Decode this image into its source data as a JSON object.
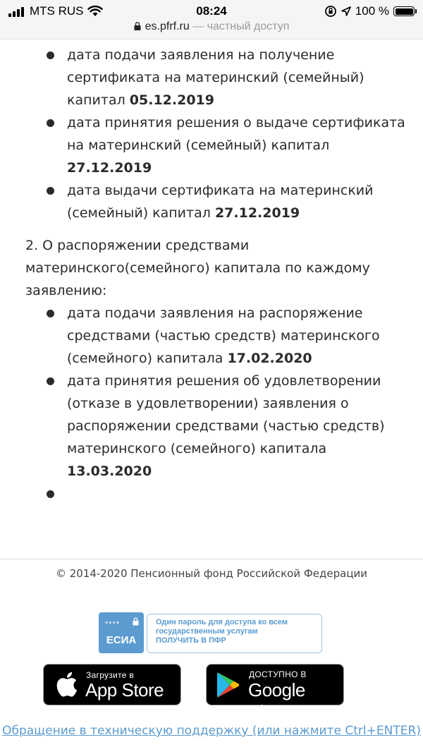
{
  "status_bar": {
    "carrier": "MTS RUS",
    "time": "08:24",
    "battery": "100 %"
  },
  "url_bar": {
    "domain": "es.pfrf.ru",
    "subtitle": "— частный доступ"
  },
  "content": {
    "list1": [
      {
        "text": "дата подачи заявления на получение сертификата на материнский (семейный) капитал ",
        "date": "05.12.2019"
      },
      {
        "text": "дата принятия решения о выдаче сертификата на материнский (семейный) капитал ",
        "date": "27.12.2019"
      },
      {
        "text": "дата выдачи сертификата на материнский (семейный) капитал ",
        "date": "27.12.2019"
      }
    ],
    "section2_heading": "2. О распоряжении средствами материнского(семейного) капитала по каждому заявлению:",
    "list2": [
      {
        "text": "дата подачи заявления на распоряжение средствами (частью средств) материнского (семейного) капитала ",
        "date": "17.02.2020"
      },
      {
        "text": "дата принятия решения об удовлетворении (отказе в удовлетворении) заявления о распоряжении средствами (частью средств) материнского (семейного) капитала ",
        "date": "13.03.2020"
      },
      {
        "text": "",
        "date": ""
      }
    ]
  },
  "footer": {
    "copyright": "© 2014-2020 Пенсионный фонд Российской Федерации",
    "esia": {
      "stars": "****",
      "name": "ЕСИА",
      "line1": "Один пароль для доступа ко всем",
      "line2": "государственным услугам",
      "line3": "ПОЛУЧИТЬ В ПФР"
    },
    "app_store": {
      "small": "Загрузите в",
      "big": "App Store"
    },
    "google_play": {
      "small": "ДОСТУПНО В",
      "big": "Google Play"
    },
    "support_link": "Обращение в техническую поддержку (или нажмите Ctrl+ENTER)"
  }
}
